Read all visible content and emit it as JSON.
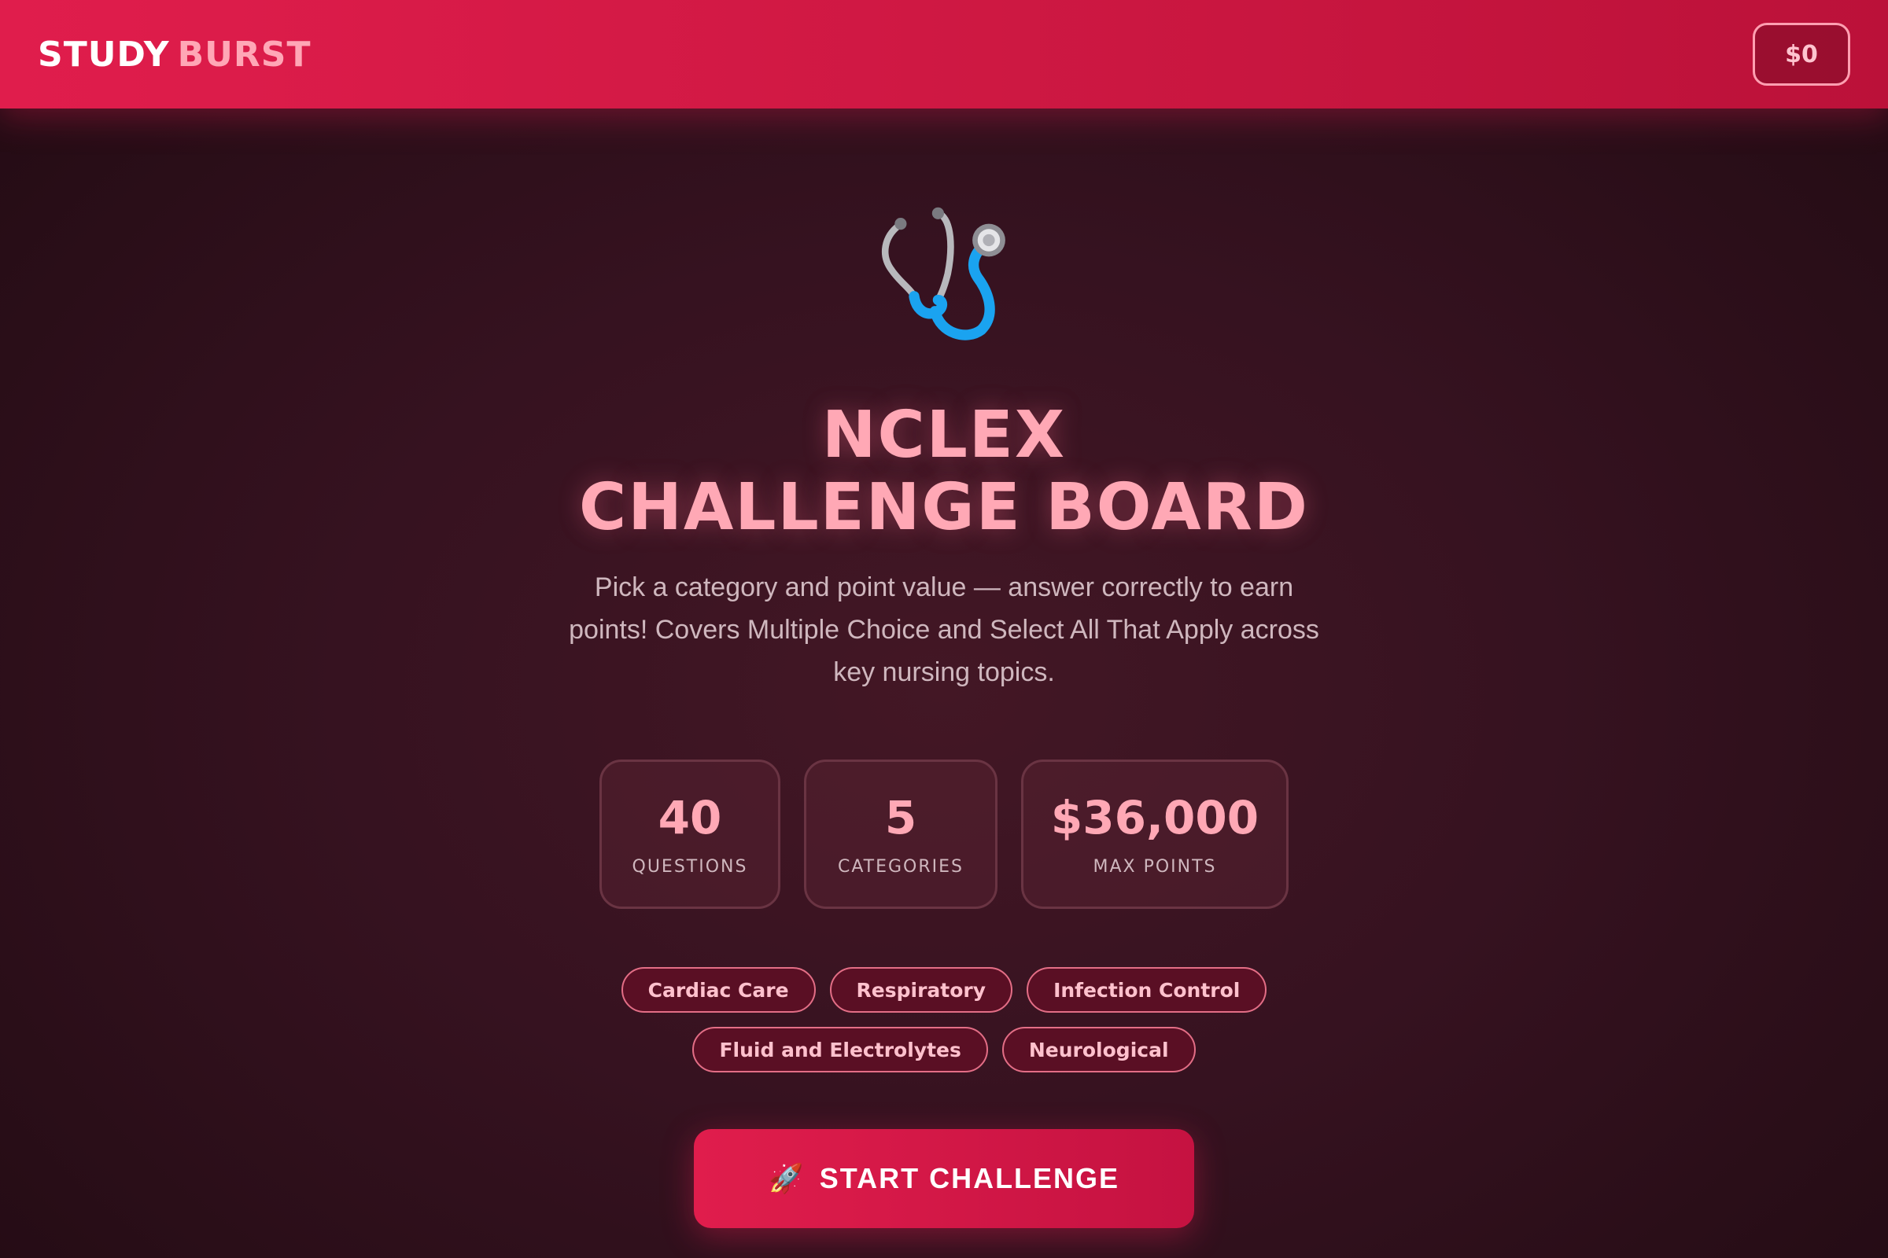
{
  "header": {
    "brand_word1": "STUDY",
    "brand_word2": "BURST",
    "score": "$0"
  },
  "hero": {
    "icon": "stethoscope-icon",
    "title_line1": "NCLEX",
    "title_line2": "CHALLENGE BOARD",
    "description": "Pick a category and point value — answer correctly to earn points! Covers Multiple Choice and Select All That Apply across key nursing topics."
  },
  "stats": [
    {
      "value": "40",
      "label": "QUESTIONS"
    },
    {
      "value": "5",
      "label": "CATEGORIES"
    },
    {
      "value": "$36,000",
      "label": "MAX POINTS"
    }
  ],
  "categories": [
    "Cardiac Care",
    "Respiratory",
    "Infection Control",
    "Fluid and Electrolytes",
    "Neurological"
  ],
  "cta": {
    "icon": "rocket-icon",
    "label": "START CHALLENGE"
  },
  "colors": {
    "accent": "#e01d4c",
    "title_pink": "#ffa8b5",
    "background_dark": "#2a0e18"
  }
}
